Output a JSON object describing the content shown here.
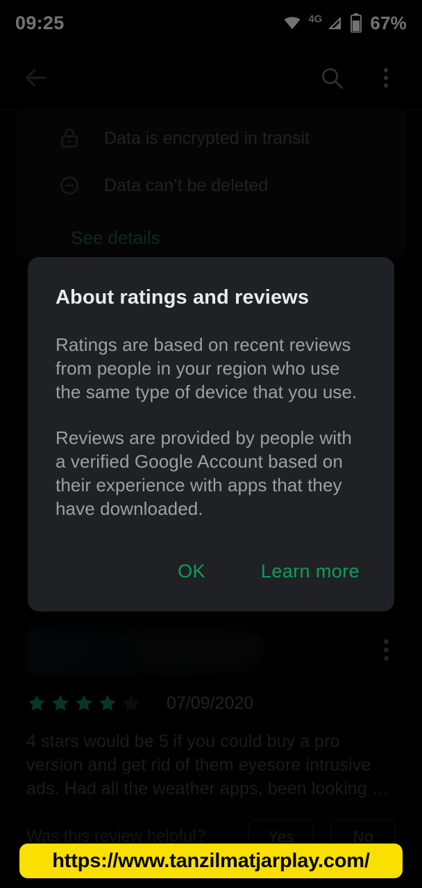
{
  "status_bar": {
    "clock": "09:25",
    "network_label": "4G",
    "battery_percent": "67%",
    "icons": [
      "wifi-icon",
      "signal-icon",
      "battery-icon"
    ]
  },
  "toolbar": {
    "back_icon": "back-arrow-icon",
    "search_icon": "search-icon",
    "overflow_icon": "overflow-menu-icon"
  },
  "data_safety": {
    "rows": [
      {
        "icon": "lock-icon",
        "label": "Data is encrypted in transit"
      },
      {
        "icon": "minus-circle-icon",
        "label": "Data can’t be deleted"
      }
    ],
    "see_details_label": "See details"
  },
  "dialog": {
    "title": "About ratings and reviews",
    "paragraph_1": "Ratings are based on recent reviews from people in your region who use the same type of device that you use.",
    "paragraph_2": "Reviews are provided by people with a verified Google Account based on their experience with apps that they have downloaded.",
    "ok_label": "OK",
    "learn_more_label": "Learn more"
  },
  "review": {
    "stars_filled": 4,
    "stars_total": 5,
    "date": "07/09/2020",
    "body": "4 stars would be 5 if you could buy a pro version and get rid of them eyesore intrusive ads. Had all the weather apps, been looking …",
    "helpful_question": "Was this review helpful?",
    "helpful_yes": "Yes",
    "helpful_no": "No",
    "overflow_icon": "overflow-menu-icon"
  },
  "url_banner": {
    "url": "https://www.tanzilmatjarplay.com/"
  },
  "colors": {
    "accent_green": "#0f9d58",
    "star_green": "#14784f",
    "banner_yellow": "#f9e000",
    "dialog_bg": "#202124",
    "page_bg": "#000000"
  }
}
